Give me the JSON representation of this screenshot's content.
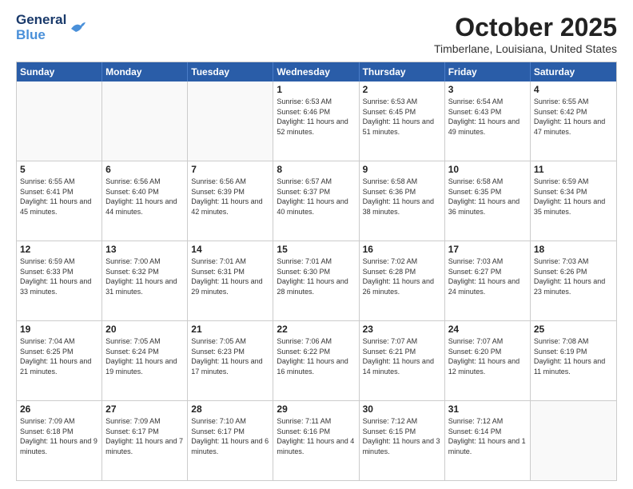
{
  "header": {
    "logo_line1": "General",
    "logo_line2": "Blue",
    "month_title": "October 2025",
    "location": "Timberlane, Louisiana, United States"
  },
  "weekdays": [
    "Sunday",
    "Monday",
    "Tuesday",
    "Wednesday",
    "Thursday",
    "Friday",
    "Saturday"
  ],
  "rows": [
    [
      {
        "day": "",
        "empty": true
      },
      {
        "day": "",
        "empty": true
      },
      {
        "day": "",
        "empty": true
      },
      {
        "day": "1",
        "sunrise": "6:53 AM",
        "sunset": "6:46 PM",
        "daylight": "11 hours and 52 minutes."
      },
      {
        "day": "2",
        "sunrise": "6:53 AM",
        "sunset": "6:45 PM",
        "daylight": "11 hours and 51 minutes."
      },
      {
        "day": "3",
        "sunrise": "6:54 AM",
        "sunset": "6:43 PM",
        "daylight": "11 hours and 49 minutes."
      },
      {
        "day": "4",
        "sunrise": "6:55 AM",
        "sunset": "6:42 PM",
        "daylight": "11 hours and 47 minutes."
      }
    ],
    [
      {
        "day": "5",
        "sunrise": "6:55 AM",
        "sunset": "6:41 PM",
        "daylight": "11 hours and 45 minutes."
      },
      {
        "day": "6",
        "sunrise": "6:56 AM",
        "sunset": "6:40 PM",
        "daylight": "11 hours and 44 minutes."
      },
      {
        "day": "7",
        "sunrise": "6:56 AM",
        "sunset": "6:39 PM",
        "daylight": "11 hours and 42 minutes."
      },
      {
        "day": "8",
        "sunrise": "6:57 AM",
        "sunset": "6:37 PM",
        "daylight": "11 hours and 40 minutes."
      },
      {
        "day": "9",
        "sunrise": "6:58 AM",
        "sunset": "6:36 PM",
        "daylight": "11 hours and 38 minutes."
      },
      {
        "day": "10",
        "sunrise": "6:58 AM",
        "sunset": "6:35 PM",
        "daylight": "11 hours and 36 minutes."
      },
      {
        "day": "11",
        "sunrise": "6:59 AM",
        "sunset": "6:34 PM",
        "daylight": "11 hours and 35 minutes."
      }
    ],
    [
      {
        "day": "12",
        "sunrise": "6:59 AM",
        "sunset": "6:33 PM",
        "daylight": "11 hours and 33 minutes."
      },
      {
        "day": "13",
        "sunrise": "7:00 AM",
        "sunset": "6:32 PM",
        "daylight": "11 hours and 31 minutes."
      },
      {
        "day": "14",
        "sunrise": "7:01 AM",
        "sunset": "6:31 PM",
        "daylight": "11 hours and 29 minutes."
      },
      {
        "day": "15",
        "sunrise": "7:01 AM",
        "sunset": "6:30 PM",
        "daylight": "11 hours and 28 minutes."
      },
      {
        "day": "16",
        "sunrise": "7:02 AM",
        "sunset": "6:28 PM",
        "daylight": "11 hours and 26 minutes."
      },
      {
        "day": "17",
        "sunrise": "7:03 AM",
        "sunset": "6:27 PM",
        "daylight": "11 hours and 24 minutes."
      },
      {
        "day": "18",
        "sunrise": "7:03 AM",
        "sunset": "6:26 PM",
        "daylight": "11 hours and 23 minutes."
      }
    ],
    [
      {
        "day": "19",
        "sunrise": "7:04 AM",
        "sunset": "6:25 PM",
        "daylight": "11 hours and 21 minutes."
      },
      {
        "day": "20",
        "sunrise": "7:05 AM",
        "sunset": "6:24 PM",
        "daylight": "11 hours and 19 minutes."
      },
      {
        "day": "21",
        "sunrise": "7:05 AM",
        "sunset": "6:23 PM",
        "daylight": "11 hours and 17 minutes."
      },
      {
        "day": "22",
        "sunrise": "7:06 AM",
        "sunset": "6:22 PM",
        "daylight": "11 hours and 16 minutes."
      },
      {
        "day": "23",
        "sunrise": "7:07 AM",
        "sunset": "6:21 PM",
        "daylight": "11 hours and 14 minutes."
      },
      {
        "day": "24",
        "sunrise": "7:07 AM",
        "sunset": "6:20 PM",
        "daylight": "11 hours and 12 minutes."
      },
      {
        "day": "25",
        "sunrise": "7:08 AM",
        "sunset": "6:19 PM",
        "daylight": "11 hours and 11 minutes."
      }
    ],
    [
      {
        "day": "26",
        "sunrise": "7:09 AM",
        "sunset": "6:18 PM",
        "daylight": "11 hours and 9 minutes."
      },
      {
        "day": "27",
        "sunrise": "7:09 AM",
        "sunset": "6:17 PM",
        "daylight": "11 hours and 7 minutes."
      },
      {
        "day": "28",
        "sunrise": "7:10 AM",
        "sunset": "6:17 PM",
        "daylight": "11 hours and 6 minutes."
      },
      {
        "day": "29",
        "sunrise": "7:11 AM",
        "sunset": "6:16 PM",
        "daylight": "11 hours and 4 minutes."
      },
      {
        "day": "30",
        "sunrise": "7:12 AM",
        "sunset": "6:15 PM",
        "daylight": "11 hours and 3 minutes."
      },
      {
        "day": "31",
        "sunrise": "7:12 AM",
        "sunset": "6:14 PM",
        "daylight": "11 hours and 1 minute."
      },
      {
        "day": "",
        "empty": true
      }
    ]
  ]
}
